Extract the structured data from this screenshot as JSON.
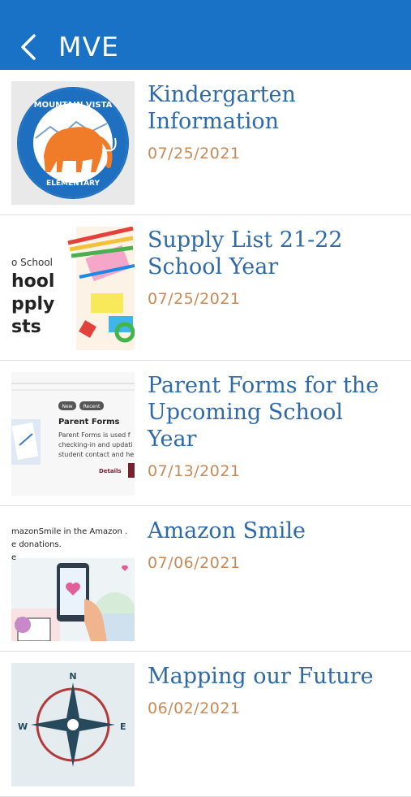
{
  "header": {
    "title": "MVE",
    "back_icon": "chevron-left-icon",
    "color": "#1a72c6"
  },
  "items": [
    {
      "title": "Kindergarten Information",
      "date": "07/25/2021",
      "thumb_text": {
        "top": "MOUNTAIN VISTA",
        "bottom": "ELEMENTARY"
      }
    },
    {
      "title": "Supply List 21-22 School Year",
      "date": "07/25/2021",
      "thumb_text": {
        "l1": "o School",
        "l2": "hool",
        "l3": "pply",
        "l4": "sts"
      }
    },
    {
      "title": "Parent Forms for the Upcoming School Year",
      "date": "07/13/2021",
      "thumb_text": {
        "chip1": "New",
        "chip2": "Recent",
        "heading": "Parent Forms",
        "body1": "Parent Forms is used f",
        "body2": "checking-in and updati",
        "body3": "student contact and he",
        "link": "Details"
      }
    },
    {
      "title": "Amazon Smile",
      "date": "07/06/2021",
      "thumb_text": {
        "l1": "mazonSmile in the Amazon .",
        "l2": "e donations.",
        "l3": "e"
      }
    },
    {
      "title": "Mapping our Future",
      "date": "06/02/2021",
      "thumb_text": {
        "n": "N",
        "w": "W",
        "e": "E"
      }
    }
  ],
  "colors": {
    "title": "#2e6aa8",
    "date": "#c98a58"
  }
}
